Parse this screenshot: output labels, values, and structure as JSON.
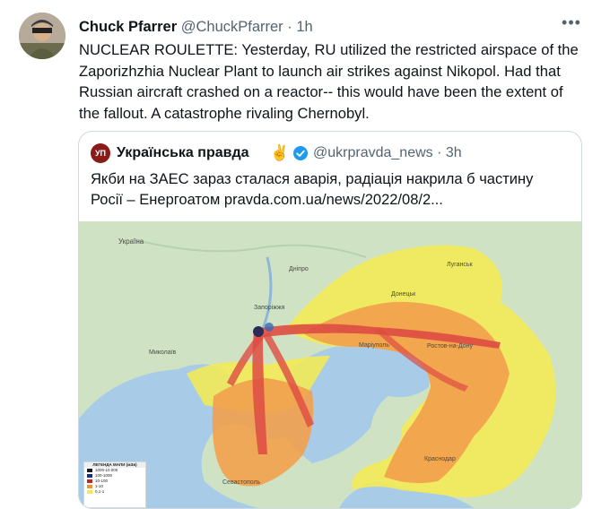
{
  "tweet": {
    "author_name": "Chuck Pfarrer",
    "author_handle": "@ChuckPfarrer",
    "separator": "·",
    "time": "1h",
    "more_icon": "more-horizontal-icon",
    "text_lines": [
      "NUCLEAR ROULETTE: Yesterday, RU utilized the restricted airspace of the",
      "Zaporizhzhia Nuclear Plant to launch air strikes against Nikopol.  Had that",
      "Russian aircraft crashed on a reactor-- this would have been the extent of",
      "the fallout.   A catastrophe rivaling Chernobyl."
    ]
  },
  "quote": {
    "logo_text": "УП",
    "name": "Українська правда",
    "emoji": "✌️",
    "verified_icon": "verified-badge-icon",
    "handle": "@ukrpravda_news",
    "separator": "·",
    "time": "3h",
    "text_lines": [
      "Якби на ЗАЕС зараз сталася аварія, радіація накрила б частину",
      "Росії – Енергоатом pravda.com.ua/news/2022/08/2..."
    ]
  },
  "map": {
    "labels": [
      "Україна",
      "Дніпро",
      "Запоріжжя",
      "Маріуполь",
      "Ростов-на-Дону",
      "Миколаїв",
      "Севастополь",
      "Краснодар",
      "Донецьк",
      "Луганськ"
    ],
    "legend": {
      "title": "ЛЕГЕНДА МАПИ (мЗв)",
      "rows": [
        {
          "label": "1000-10 000",
          "color": "#1a1a1a"
        },
        {
          "label": "100-1000",
          "color": "#1f2a8a"
        },
        {
          "label": "10-100",
          "color": "#c0262b"
        },
        {
          "label": "1-10",
          "color": "#f0932e"
        },
        {
          "label": "0,1-1",
          "color": "#ffe94a"
        }
      ]
    },
    "colors": {
      "land": "#cfe3c4",
      "sea": "#a8cce8",
      "fallout_low": "#f2ea58",
      "fallout_mid": "#f2a04c",
      "fallout_high": "#de4b43"
    }
  }
}
